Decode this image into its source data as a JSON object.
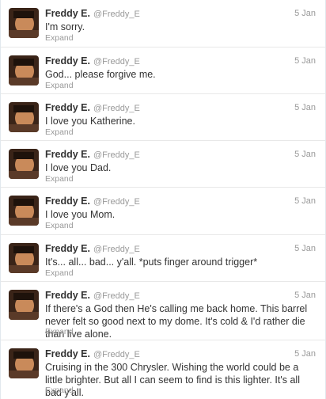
{
  "author": {
    "name": "Freddy E.",
    "handle": "@Freddy_E"
  },
  "expand_label": "Expand",
  "tweets": [
    {
      "date": "5 Jan",
      "text": "I'm sorry."
    },
    {
      "date": "5 Jan",
      "text": "God... please forgive me."
    },
    {
      "date": "5 Jan",
      "text": "I love you Katherine."
    },
    {
      "date": "5 Jan",
      "text": "I love you Dad."
    },
    {
      "date": "5 Jan",
      "text": "I love you Mom."
    },
    {
      "date": "5 Jan",
      "text": "It's... all... bad... y'all. *puts finger around trigger*"
    },
    {
      "date": "5 Jan",
      "text": "If there's a God then He's calling me back home. This barrel never felt so good next to my dome. It's cold & I'd rather die than live alone."
    },
    {
      "date": "5 Jan",
      "text": "Cruising in the 300 Chrysler. Wishing the world could be a little brighter. But all I can seem to find is this lighter. It's all bad y'all."
    }
  ]
}
